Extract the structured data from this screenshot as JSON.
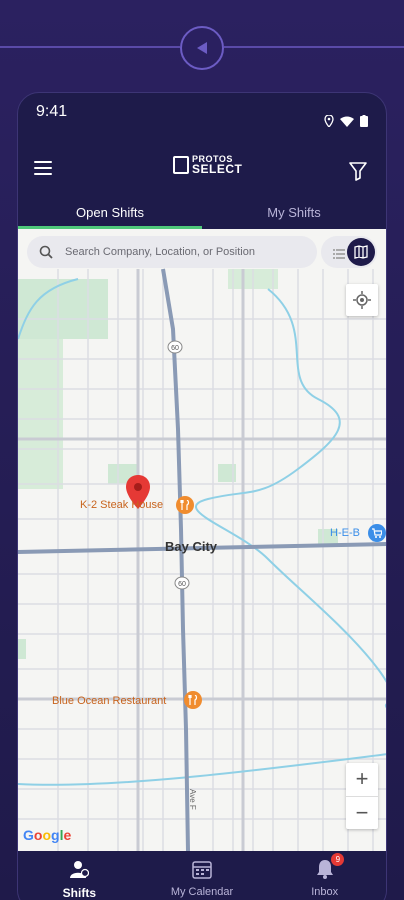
{
  "status": {
    "time": "9:41"
  },
  "header": {
    "logo_line1": "PROTOS",
    "logo_line2": "SELECT"
  },
  "tabs": [
    {
      "label": "Open Shifts",
      "active": true
    },
    {
      "label": "My Shifts",
      "active": false
    }
  ],
  "search": {
    "placeholder": "Search Company, Location, or Position"
  },
  "map": {
    "city": "Bay City",
    "places": [
      {
        "name": "K-2 Steak House",
        "type": "restaurant"
      },
      {
        "name": "Blue Ocean Restaurant",
        "type": "restaurant"
      },
      {
        "name": "H-E-B",
        "type": "store"
      }
    ],
    "highways": [
      "60",
      "60"
    ],
    "road_label": "Ave F",
    "zoom_in": "+",
    "zoom_out": "−",
    "attribution": [
      "G",
      "o",
      "o",
      "g",
      "l",
      "e"
    ]
  },
  "nav": [
    {
      "label": "Shifts",
      "icon": "user-shifts-icon",
      "active": true
    },
    {
      "label": "My Calendar",
      "icon": "calendar-icon",
      "active": false
    },
    {
      "label": "Inbox",
      "icon": "bell-icon",
      "active": false,
      "badge": "9"
    }
  ],
  "colors": {
    "brand": "#1e1b4a",
    "active_tab_underline": "#4fc87a",
    "pin": "#e53935",
    "poi": "#f08c2e"
  }
}
